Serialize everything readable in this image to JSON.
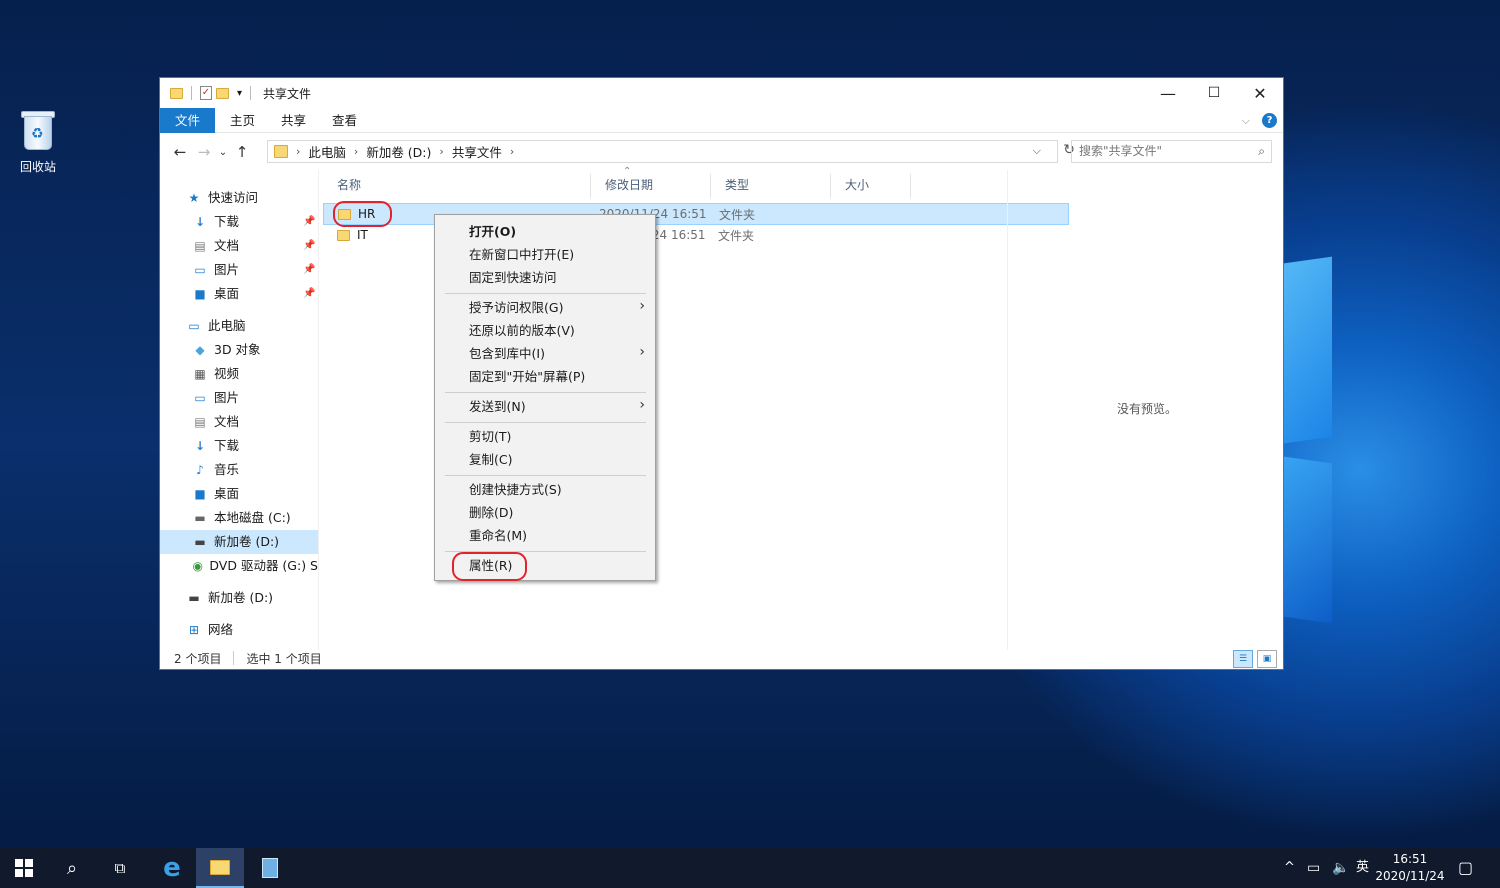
{
  "desktop": {
    "recycle_bin_label": "回收站"
  },
  "window": {
    "title": "共享文件",
    "controls": {
      "minimize": "—",
      "maximize": "☐",
      "close": "✕"
    },
    "ribbon_tabs": [
      "文件",
      "主页",
      "共享",
      "查看"
    ],
    "address": {
      "crumbs": [
        "此电脑",
        "新加卷 (D:)",
        "共享文件"
      ]
    },
    "search_placeholder": "搜索\"共享文件\"",
    "nav_pane": {
      "quick_access": "快速访问",
      "quick_items": [
        "下载",
        "文档",
        "图片",
        "桌面"
      ],
      "this_pc": "此电脑",
      "pc_items": [
        "3D 对象",
        "视频",
        "图片",
        "文档",
        "下载",
        "音乐",
        "桌面",
        "本地磁盘 (C:)",
        "新加卷 (D:)",
        "DVD 驱动器 (G:) S"
      ],
      "drive_d": "新加卷 (D:)",
      "network": "网络"
    },
    "columns": [
      "名称",
      "修改日期",
      "类型",
      "大小"
    ],
    "files": [
      {
        "name": "HR",
        "date": "2020/11/24 16:51",
        "type": "文件夹",
        "selected": true
      },
      {
        "name": "IT",
        "date": "2020/11/24 16:51",
        "type": "文件夹",
        "selected": false
      }
    ],
    "preview_text": "没有预览。",
    "status": {
      "count": "2 个项目",
      "selection": "选中 1 个项目"
    }
  },
  "context_menu": {
    "groups": [
      [
        "打开(O)",
        "在新窗口中打开(E)",
        "固定到快速访问"
      ],
      [
        "授予访问权限(G)",
        "还原以前的版本(V)",
        "包含到库中(I)",
        "固定到\"开始\"屏幕(P)"
      ],
      [
        "发送到(N)"
      ],
      [
        "剪切(T)",
        "复制(C)"
      ],
      [
        "创建快捷方式(S)",
        "删除(D)",
        "重命名(M)"
      ],
      [
        "属性(R)"
      ]
    ]
  },
  "taskbar": {
    "clock_time": "16:51",
    "clock_date": "2020/11/24",
    "ime": "英"
  },
  "colors": {
    "accent": "#1979ca",
    "selection": "#cce8ff",
    "highlight_ring": "#e0242e"
  }
}
